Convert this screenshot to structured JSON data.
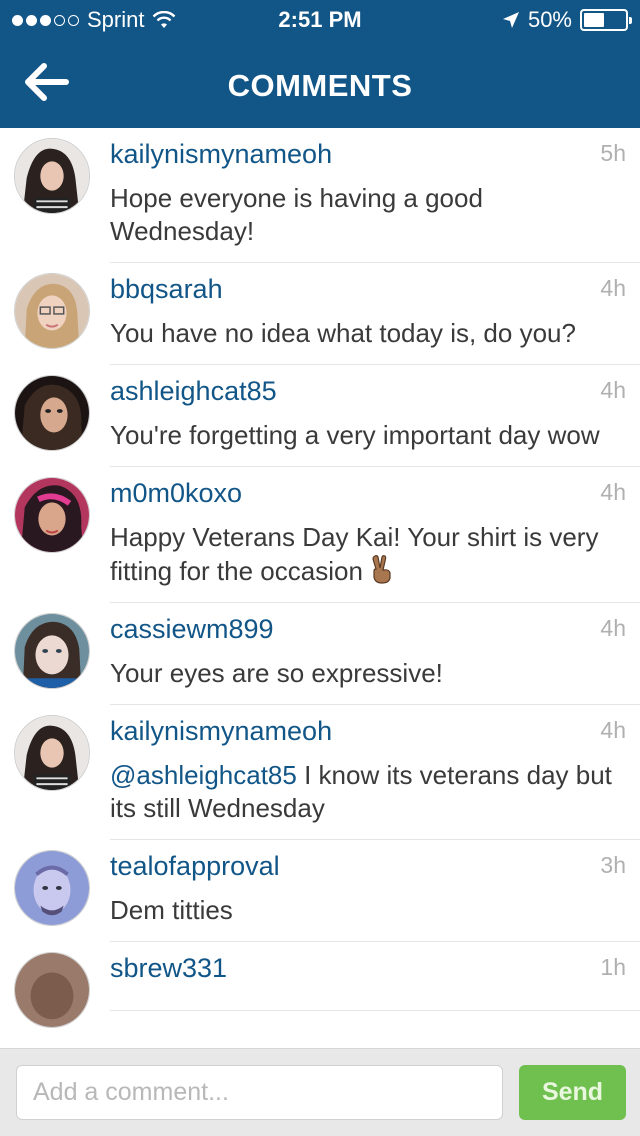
{
  "status_bar": {
    "carrier": "Sprint",
    "time": "2:51 PM",
    "battery_percent": "50%",
    "signal_bars_filled": 3,
    "signal_bars_total": 5,
    "battery_level": 0.5
  },
  "header": {
    "title": "COMMENTS",
    "background_color": "#125688",
    "back_icon": "arrow-left-icon"
  },
  "comments": [
    {
      "username": "kailynismynameoh",
      "time": "5h",
      "text": "Hope everyone is having a good Wednesday!"
    },
    {
      "username": "bbqsarah",
      "time": "4h",
      "text": "You have no idea what today is, do you?"
    },
    {
      "username": "ashleighcat85",
      "time": "4h",
      "text": "You're forgetting a very important day wow"
    },
    {
      "username": "m0m0koxo",
      "time": "4h",
      "text": "Happy Veterans Day Kai! Your shirt is very fitting for the occasion",
      "emoji": "victory-hand-emoji"
    },
    {
      "username": "cassiewm899",
      "time": "4h",
      "text": "Your eyes are so expressive!"
    },
    {
      "username": "kailynismynameoh",
      "time": "4h",
      "mention": "@ashleighcat85",
      "text": " I know its veterans day but its still Wednesday"
    },
    {
      "username": "tealofapproval",
      "time": "3h",
      "text": "Dem titties"
    },
    {
      "username": "sbrew331",
      "time": "1h",
      "text": ""
    }
  ],
  "composer": {
    "placeholder": "Add a comment...",
    "send_label": "Send",
    "send_color": "#70c050"
  }
}
